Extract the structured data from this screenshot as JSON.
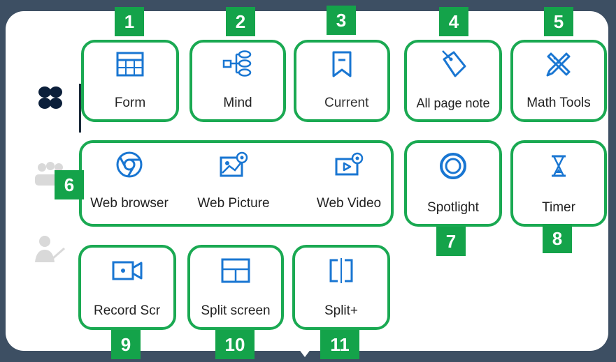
{
  "tools": {
    "form": "Form",
    "mind": "Mind",
    "current": "Current",
    "all_page_note": "All page note",
    "math_tools": "Math Tools",
    "web_browser": "Web browser",
    "web_picture": "Web Picture",
    "web_video": "Web Video",
    "spotlight": "Spotlight",
    "timer": "Timer",
    "record_screen": "Record Scr",
    "split_screen": "Split screen",
    "split_plus": "Split+"
  },
  "badges": [
    "1",
    "2",
    "3",
    "4",
    "5",
    "6",
    "7",
    "8",
    "9",
    "10",
    "11"
  ],
  "colors": {
    "accent": "#1976d2",
    "highlight": "#1aa952",
    "badge": "#14a34a",
    "background": "#3d4f63",
    "active_category": "#0b1f3a",
    "inactive_category": "#d9d9d9"
  },
  "sidebar": {
    "categories": [
      {
        "icon": "four-petal-apps-icon",
        "state": "active"
      },
      {
        "icon": "group-people-icon",
        "state": "inactive"
      },
      {
        "icon": "teacher-icon",
        "state": "inactive"
      }
    ]
  }
}
